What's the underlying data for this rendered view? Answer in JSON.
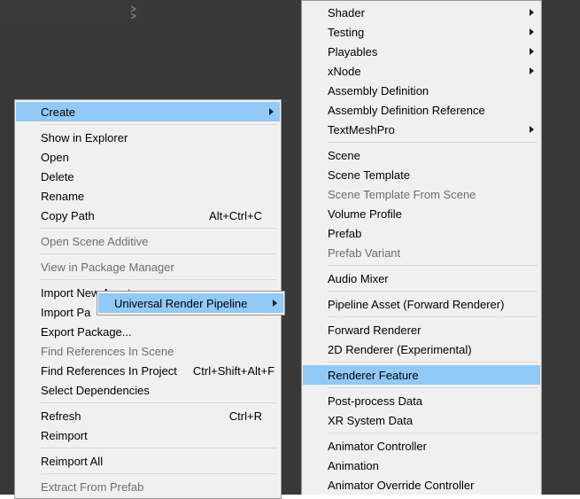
{
  "menu1": {
    "groups": [
      [
        {
          "label": "Create",
          "highlight": true,
          "sub": true
        }
      ],
      [
        {
          "label": "Show in Explorer"
        },
        {
          "label": "Open"
        },
        {
          "label": "Delete"
        },
        {
          "label": "Rename"
        },
        {
          "label": "Copy Path",
          "shortcut": "Alt+Ctrl+C"
        }
      ],
      [
        {
          "label": "Open Scene Additive",
          "disabled": true
        }
      ],
      [
        {
          "label": "View in Package Manager",
          "disabled": true
        }
      ],
      [
        {
          "label": "Import New Asset..."
        },
        {
          "label": "Import Pa"
        },
        {
          "label": "Export Package..."
        },
        {
          "label": "Find References In Scene",
          "disabled": true
        },
        {
          "label": "Find References In Project",
          "shortcut": "Ctrl+Shift+Alt+F"
        },
        {
          "label": "Select Dependencies"
        }
      ],
      [
        {
          "label": "Refresh",
          "shortcut": "Ctrl+R"
        },
        {
          "label": "Reimport"
        }
      ],
      [
        {
          "label": "Reimport All"
        }
      ],
      [
        {
          "label": "Extract From Prefab",
          "disabled": true
        }
      ]
    ]
  },
  "menu2": {
    "groups": [
      [
        {
          "label": "Shader",
          "sub": true
        },
        {
          "label": "Testing",
          "sub": true
        },
        {
          "label": "Playables",
          "sub": true
        },
        {
          "label": "xNode",
          "sub": true
        },
        {
          "label": "Assembly Definition"
        },
        {
          "label": "Assembly Definition Reference"
        },
        {
          "label": "TextMeshPro",
          "sub": true
        }
      ],
      [
        {
          "label": "Scene"
        },
        {
          "label": "Scene Template"
        },
        {
          "label": "Scene Template From Scene",
          "disabled": true
        },
        {
          "label": "Volume Profile"
        },
        {
          "label": "Prefab"
        },
        {
          "label": "Prefab Variant",
          "disabled": true
        }
      ],
      [
        {
          "label": "Audio Mixer"
        }
      ],
      [
        {
          "label": "Pipeline Asset (Forward Renderer)"
        }
      ],
      [
        {
          "label": "Forward Renderer"
        },
        {
          "label": "2D Renderer (Experimental)"
        }
      ],
      [
        {
          "label": "Renderer Feature",
          "highlight": true
        }
      ],
      [
        {
          "label": "Post-process Data"
        },
        {
          "label": "XR System Data"
        }
      ],
      [
        {
          "label": "Animator Controller"
        },
        {
          "label": "Animation"
        },
        {
          "label": "Animator Override Controller"
        }
      ]
    ]
  },
  "menu3": {
    "label": "Universal Render Pipeline"
  }
}
